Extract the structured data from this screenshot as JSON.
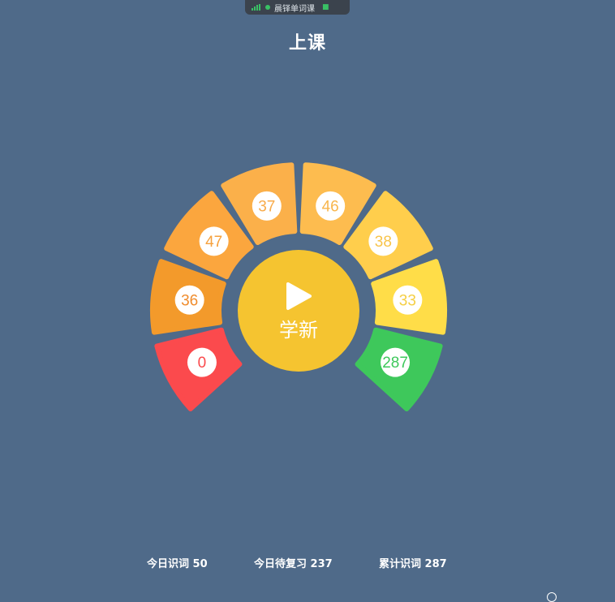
{
  "topbar": {
    "title": "晨铎单词课"
  },
  "page": {
    "title": "上课"
  },
  "center": {
    "label": "学新",
    "color": "#f5c430"
  },
  "segments": [
    {
      "value": "0",
      "color": "#fb4a4d",
      "text_color": "#fb4a4d"
    },
    {
      "value": "36",
      "color": "#f39a2b",
      "text_color": "#f08c2d"
    },
    {
      "value": "47",
      "color": "#fba63e",
      "text_color": "#f6a13d"
    },
    {
      "value": "37",
      "color": "#fbb04a",
      "text_color": "#f8ab4a"
    },
    {
      "value": "46",
      "color": "#fdbc4f",
      "text_color": "#f8b64d"
    },
    {
      "value": "38",
      "color": "#ffce4c",
      "text_color": "#f8c44a"
    },
    {
      "value": "33",
      "color": "#ffdd48",
      "text_color": "#f5cf44"
    },
    {
      "value": "287",
      "color": "#3ec85b",
      "text_color": "#3ec85b"
    }
  ],
  "stats": {
    "today_new": "今日识词 50",
    "today_review": "今日待复习 237",
    "total": "累计识词 287"
  }
}
